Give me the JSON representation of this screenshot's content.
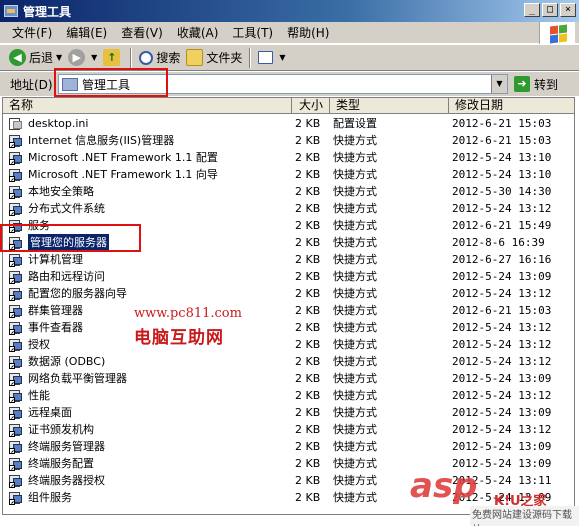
{
  "window": {
    "title": "管理工具"
  },
  "menu": [
    "文件(F)",
    "编辑(E)",
    "查看(V)",
    "收藏(A)",
    "工具(T)",
    "帮助(H)"
  ],
  "toolbar": {
    "back": "后退",
    "search": "搜索",
    "folders": "文件夹"
  },
  "address": {
    "label": "地址(D)",
    "value": "管理工具",
    "go": "转到"
  },
  "columns": {
    "name": "名称",
    "size": "大小",
    "type": "类型",
    "date": "修改日期"
  },
  "files": [
    {
      "name": "desktop.ini",
      "size": "2 KB",
      "type": "配置设置",
      "date": "2012-6-21 15:03",
      "icon": "ini-file-icon"
    },
    {
      "name": "Internet 信息服务(IIS)管理器",
      "size": "2 KB",
      "type": "快捷方式",
      "date": "2012-6-21 15:03",
      "icon": "iis-shortcut-icon"
    },
    {
      "name": "Microsoft .NET Framework 1.1 配置",
      "size": "2 KB",
      "type": "快捷方式",
      "date": "2012-5-24 13:10",
      "icon": "dotnet-config-shortcut-icon"
    },
    {
      "name": "Microsoft .NET Framework 1.1 向导",
      "size": "2 KB",
      "type": "快捷方式",
      "date": "2012-5-24 13:10",
      "icon": "dotnet-wizard-shortcut-icon"
    },
    {
      "name": "本地安全策略",
      "size": "2 KB",
      "type": "快捷方式",
      "date": "2012-5-30 14:30",
      "icon": "local-security-policy-icon"
    },
    {
      "name": "分布式文件系统",
      "size": "2 KB",
      "type": "快捷方式",
      "date": "2012-5-24 13:12",
      "icon": "dfs-shortcut-icon"
    },
    {
      "name": "服务",
      "size": "2 KB",
      "type": "快捷方式",
      "date": "2012-6-21 15:49",
      "icon": "services-shortcut-icon"
    },
    {
      "name": "管理您的服务器",
      "size": "2 KB",
      "type": "快捷方式",
      "date": "2012-8-6 16:39",
      "icon": "manage-server-shortcut-icon",
      "selected": true
    },
    {
      "name": "计算机管理",
      "size": "2 KB",
      "type": "快捷方式",
      "date": "2012-6-27 16:16",
      "icon": "computer-management-icon"
    },
    {
      "name": "路由和远程访问",
      "size": "2 KB",
      "type": "快捷方式",
      "date": "2012-5-24 13:09",
      "icon": "routing-remote-access-icon"
    },
    {
      "name": "配置您的服务器向导",
      "size": "2 KB",
      "type": "快捷方式",
      "date": "2012-5-24 13:12",
      "icon": "configure-server-wizard-icon"
    },
    {
      "name": "群集管理器",
      "size": "2 KB",
      "type": "快捷方式",
      "date": "2012-6-21 15:03",
      "icon": "cluster-manager-icon"
    },
    {
      "name": "事件查看器",
      "size": "2 KB",
      "type": "快捷方式",
      "date": "2012-5-24 13:12",
      "icon": "event-viewer-icon"
    },
    {
      "name": "授权",
      "size": "2 KB",
      "type": "快捷方式",
      "date": "2012-5-24 13:12",
      "icon": "licensing-icon"
    },
    {
      "name": "数据源 (ODBC)",
      "size": "2 KB",
      "type": "快捷方式",
      "date": "2012-5-24 13:12",
      "icon": "odbc-icon"
    },
    {
      "name": "网络负载平衡管理器",
      "size": "2 KB",
      "type": "快捷方式",
      "date": "2012-5-24 13:09",
      "icon": "nlb-manager-icon"
    },
    {
      "name": "性能",
      "size": "2 KB",
      "type": "快捷方式",
      "date": "2012-5-24 13:12",
      "icon": "performance-icon"
    },
    {
      "name": "远程桌面",
      "size": "2 KB",
      "type": "快捷方式",
      "date": "2012-5-24 13:09",
      "icon": "remote-desktop-icon"
    },
    {
      "name": "证书颁发机构",
      "size": "2 KB",
      "type": "快捷方式",
      "date": "2012-5-24 13:12",
      "icon": "certificate-authority-icon"
    },
    {
      "name": "终端服务管理器",
      "size": "2 KB",
      "type": "快捷方式",
      "date": "2012-5-24 13:09",
      "icon": "terminal-services-manager-icon"
    },
    {
      "name": "终端服务配置",
      "size": "2 KB",
      "type": "快捷方式",
      "date": "2012-5-24 13:09",
      "icon": "terminal-services-config-icon"
    },
    {
      "name": "终端服务器授权",
      "size": "2 KB",
      "type": "快捷方式",
      "date": "2012-5-24 13:11",
      "icon": "terminal-server-licensing-icon"
    },
    {
      "name": "组件服务",
      "size": "2 KB",
      "type": "快捷方式",
      "date": "2012-5-24 13:09",
      "icon": "component-services-icon"
    }
  ],
  "watermarks": {
    "site_url": "www.pc811.com",
    "site_name": "电脑互助网",
    "asp": "asp",
    "jz": "K!U之家",
    "sub": "免费网站建设源码下载站"
  }
}
